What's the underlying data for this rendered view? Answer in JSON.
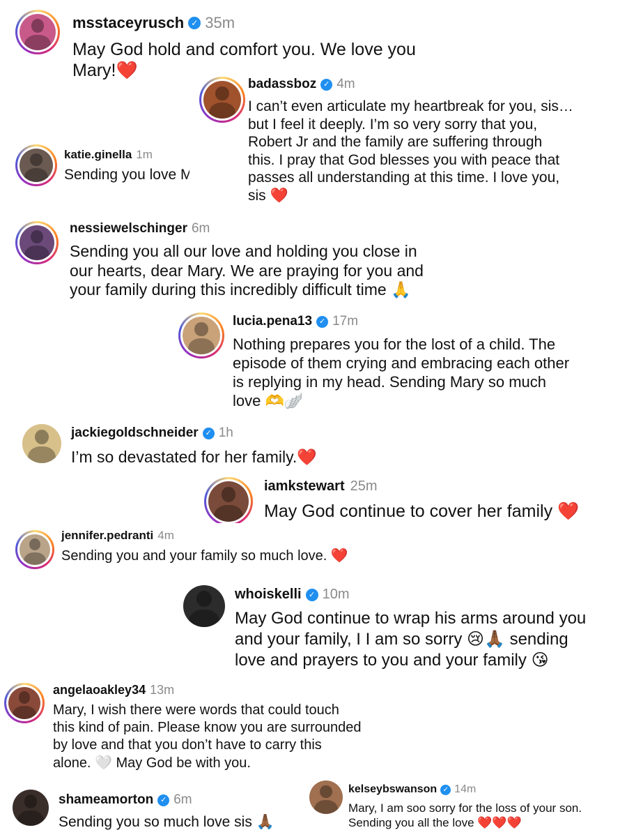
{
  "colors": {
    "verified": "#1f8ff0",
    "heart": "#e0202a",
    "timestamp": "#8a8a8a",
    "ring_gradient": [
      "#feda75",
      "#fa7e1e",
      "#d62976",
      "#962fbf",
      "#4f5bd5"
    ]
  },
  "icons": {
    "verified": "verified-badge-icon",
    "heart": "red-heart-emoji",
    "pray": "praying-hands-emoji"
  },
  "comments": [
    {
      "username": "msstaceyrusch",
      "verified": true,
      "time": "35m",
      "text": "May God hold and comfort you. We love you\nMary!",
      "emoji": "❤️"
    },
    {
      "username": "badassboz",
      "verified": true,
      "time": "4m",
      "text": "I can’t even articulate my heartbreak for you, sis…\nbut I feel it deeply. I’m so very sorry that you,\nRobert Jr and the family are suffering through\nthis. I pray that God blesses you with peace that\npasses all understanding at this time. I love you,\nsis",
      "emoji": "❤️"
    },
    {
      "username": "katie.ginella",
      "verified": false,
      "time": "1m",
      "text": "Sending you love Mary.",
      "emoji": ""
    },
    {
      "username": "nessiewelschinger",
      "verified": false,
      "time": "6m",
      "text": "Sending you all our love and holding you close in\nour hearts, dear Mary. We are praying for you and\nyour family during this incredibly difficult time",
      "emoji": "🙏"
    },
    {
      "username": "lucia.pena13",
      "verified": true,
      "time": "17m",
      "text": "Nothing prepares you for the lost of a child. The\nepisode of them crying and embracing each other\nis replying in my head. Sending Mary so much\nlove",
      "emoji": "🫶🪽"
    },
    {
      "username": "jackiegoldschneider",
      "verified": true,
      "time": "1h",
      "text": "I’m so devastated for her family.",
      "emoji": "❤️"
    },
    {
      "username": "iamkstewart",
      "verified": false,
      "time": "25m",
      "text": "May God continue to cover her family",
      "emoji": "❤️"
    },
    {
      "username": "jennifer.pedranti",
      "verified": false,
      "time": "4m",
      "text": "Sending you and your family so much love.",
      "emoji": "❤️"
    },
    {
      "username": "whoiskelli",
      "verified": true,
      "time": "10m",
      "text_parts": [
        "May God continue to wrap his arms around you\nand your family, I I am so sorry ",
        " sending\nlove and prayers to you and your family "
      ],
      "emojis": [
        "😢🙏🏾",
        "😘"
      ]
    },
    {
      "username": "angelaoakley34",
      "verified": false,
      "time": "13m",
      "text_parts": [
        "Mary, I wish there were words that could touch\nthis kind of pain. Please know you are surrounded\nby love and that you don’t have to carry this\nalone. ",
        " May God be with you."
      ],
      "emojis": [
        "🤍"
      ]
    },
    {
      "username": "shameamorton",
      "verified": true,
      "time": "6m",
      "text": "Sending you so much love sis",
      "emoji": "🙏🏾"
    },
    {
      "username": "kelseybswanson",
      "verified": true,
      "time": "14m",
      "text": "Mary, I am soo sorry for the loss of your son.\nSending you all the love",
      "emoji": "❤️❤️❤️"
    }
  ]
}
